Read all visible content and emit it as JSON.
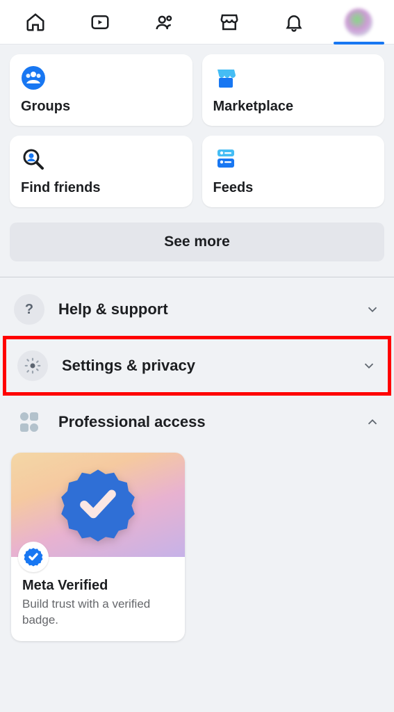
{
  "nav": {
    "items": [
      "home",
      "watch",
      "friends",
      "marketplace",
      "notifications",
      "profile"
    ]
  },
  "shortcuts": {
    "groups": {
      "label": "Groups"
    },
    "marketplace": {
      "label": "Marketplace"
    },
    "find_friends": {
      "label": "Find friends"
    },
    "feeds": {
      "label": "Feeds"
    }
  },
  "see_more": "See more",
  "menu": {
    "help": {
      "label": "Help & support"
    },
    "settings": {
      "label": "Settings & privacy"
    },
    "professional": {
      "label": "Professional access"
    }
  },
  "meta_verified": {
    "title": "Meta Verified",
    "subtitle": "Build trust with a verified badge."
  }
}
